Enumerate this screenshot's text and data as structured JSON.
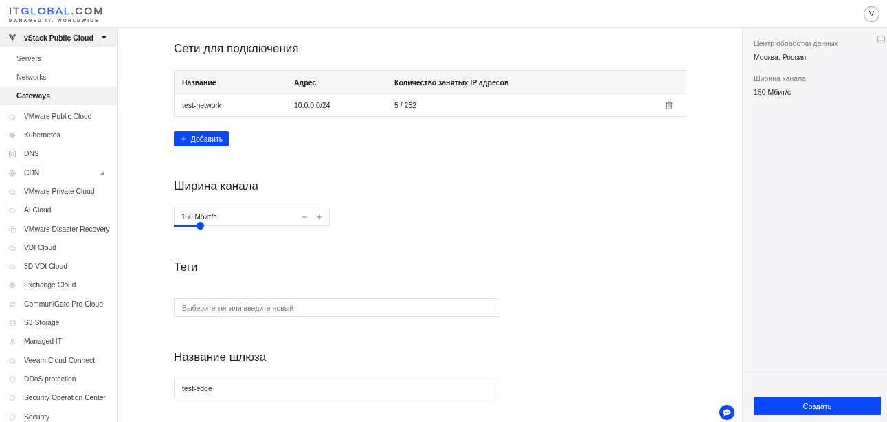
{
  "header": {
    "logo": {
      "wordmark": [
        {
          "text": "IT",
          "accent": false
        },
        {
          "text": "GLOBAL",
          "accent": true
        },
        {
          "text": ".COM",
          "accent": false
        }
      ],
      "tagline": "MANAGED IT. WORLDWIDE"
    },
    "avatar": "V"
  },
  "sidebar": {
    "items": [
      {
        "label": "vStack Public Cloud",
        "expanded": true,
        "children": [
          {
            "label": "Servers",
            "selected": false
          },
          {
            "label": "Networks",
            "selected": false
          },
          {
            "label": "Gateways",
            "selected": true
          }
        ]
      },
      {
        "label": "VMware Public Cloud",
        "selected": false
      },
      {
        "label": "Kubernetes",
        "selected": false
      },
      {
        "label": "DNS",
        "selected": false
      },
      {
        "label": "CDN",
        "expanded": false,
        "selected": false
      },
      {
        "label": "VMware Private Cloud",
        "selected": false
      },
      {
        "label": "AI Cloud",
        "selected": false
      },
      {
        "label": "VMware Disaster Recovery",
        "selected": false
      },
      {
        "label": "VDI Cloud",
        "selected": false
      },
      {
        "label": "3D VDI Cloud",
        "selected": false
      },
      {
        "label": "Exchange Cloud",
        "selected": false
      },
      {
        "label": "CommuniGate Pro Cloud",
        "selected": false
      },
      {
        "label": "S3 Storage",
        "selected": false
      },
      {
        "label": "Managed IT",
        "selected": false
      },
      {
        "label": "Veeam Cloud Connect",
        "selected": false
      },
      {
        "label": "DDoS protection",
        "selected": false
      },
      {
        "label": "Security Operation Center",
        "selected": false
      },
      {
        "label": "Security",
        "selected": false
      }
    ]
  },
  "networks": {
    "title": "Сети для подключения",
    "table": {
      "columns": [
        "Название",
        "Адрес",
        "Количество занятых IP адресов"
      ],
      "rows": [
        {
          "cells": [
            "test-network",
            "10.0.0.0/24",
            "5 / 252"
          ]
        }
      ]
    },
    "add_button": "Добавить"
  },
  "bandwidth": {
    "title": "Ширина канала",
    "value": "150 Мбит/с",
    "level": 0.17
  },
  "tags": {
    "title": "Теги",
    "placeholder": "Выберите тег или введите новый"
  },
  "gateway_name": {
    "title": "Название шлюза",
    "value": "test-edge"
  },
  "summary": {
    "fields": [
      {
        "label": "Центр обработки данных",
        "value": "Москва, Россия"
      },
      {
        "label": "Ширина канала",
        "value": "150 Мбит/с"
      }
    ],
    "submit_button": "Создать"
  }
}
